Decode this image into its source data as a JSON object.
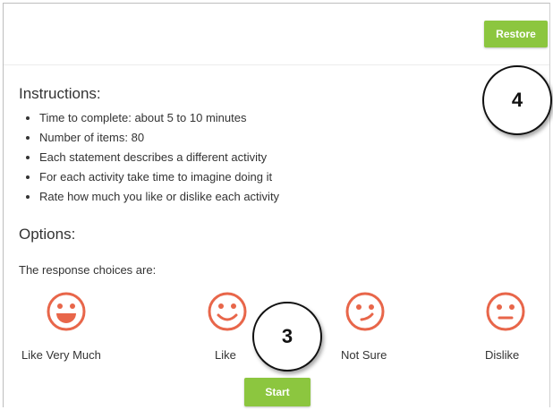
{
  "toolbar": {
    "restore_label": "Restore"
  },
  "instructions": {
    "title": "Instructions:",
    "items": [
      "Time to complete: about 5 to 10 minutes",
      "Number of items: 80",
      "Each statement describes a different activity",
      "For each activity take time to imagine doing it",
      "Rate how much you like or dislike each activity"
    ]
  },
  "options": {
    "title": "Options:",
    "response_label": "The response choices are:",
    "choices": [
      {
        "label": "Like Very Much",
        "icon": "big-smile-face-icon"
      },
      {
        "label": "Like",
        "icon": "smile-face-icon"
      },
      {
        "label": "Not Sure",
        "icon": "unsure-face-icon"
      },
      {
        "label": "Dislike",
        "icon": "neutral-face-icon"
      }
    ]
  },
  "start": {
    "label": "Start"
  },
  "callouts": {
    "top_right": "4",
    "center": "3"
  },
  "colors": {
    "accent_green": "#8cc63f",
    "face_orange": "#e8664a"
  }
}
